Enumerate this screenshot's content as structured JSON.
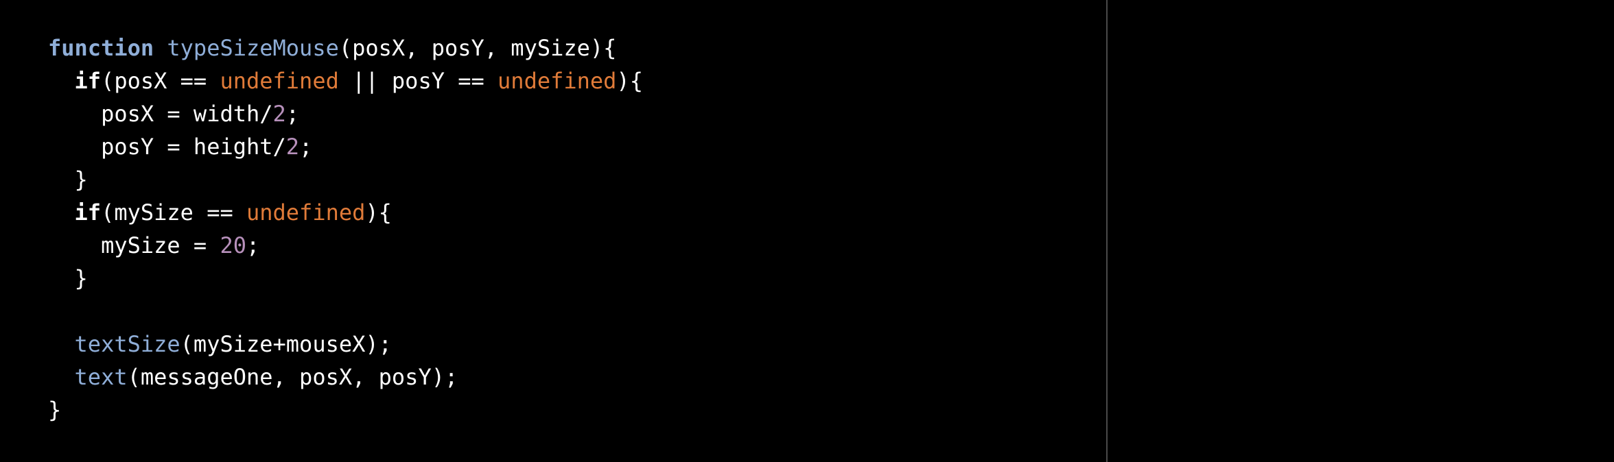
{
  "colors": {
    "background": "#000000",
    "divider": "#4a4a4a",
    "plain": "#ffffff",
    "function": "#8faed8",
    "undefined": "#e07b39",
    "number": "#b790bb"
  },
  "code": {
    "lines": [
      [
        {
          "type": "fn-keyword",
          "text": "function"
        },
        {
          "type": "plain",
          "text": " "
        },
        {
          "type": "fn-name",
          "text": "typeSizeMouse"
        },
        {
          "type": "plain",
          "text": "(posX, posY, mySize){"
        }
      ],
      [
        {
          "type": "plain",
          "text": "  "
        },
        {
          "type": "keyword",
          "text": "if"
        },
        {
          "type": "plain",
          "text": "(posX == "
        },
        {
          "type": "undef",
          "text": "undefined"
        },
        {
          "type": "plain",
          "text": " || posY == "
        },
        {
          "type": "undef",
          "text": "undefined"
        },
        {
          "type": "plain",
          "text": "){"
        }
      ],
      [
        {
          "type": "plain",
          "text": "    posX = width/"
        },
        {
          "type": "number",
          "text": "2"
        },
        {
          "type": "plain",
          "text": ";"
        }
      ],
      [
        {
          "type": "plain",
          "text": "    posY = height/"
        },
        {
          "type": "number",
          "text": "2"
        },
        {
          "type": "plain",
          "text": ";"
        }
      ],
      [
        {
          "type": "plain",
          "text": "  }"
        }
      ],
      [
        {
          "type": "plain",
          "text": "  "
        },
        {
          "type": "keyword",
          "text": "if"
        },
        {
          "type": "plain",
          "text": "(mySize == "
        },
        {
          "type": "undef",
          "text": "undefined"
        },
        {
          "type": "plain",
          "text": "){"
        }
      ],
      [
        {
          "type": "plain",
          "text": "    mySize = "
        },
        {
          "type": "number",
          "text": "20"
        },
        {
          "type": "plain",
          "text": ";"
        }
      ],
      [
        {
          "type": "plain",
          "text": "  }"
        }
      ],
      [
        {
          "type": "plain",
          "text": ""
        }
      ],
      [
        {
          "type": "plain",
          "text": "  "
        },
        {
          "type": "fn-name",
          "text": "textSize"
        },
        {
          "type": "plain",
          "text": "(mySize+mouseX);"
        }
      ],
      [
        {
          "type": "plain",
          "text": "  "
        },
        {
          "type": "fn-name",
          "text": "text"
        },
        {
          "type": "plain",
          "text": "(messageOne, posX, posY);"
        }
      ],
      [
        {
          "type": "plain",
          "text": "}"
        }
      ]
    ]
  }
}
